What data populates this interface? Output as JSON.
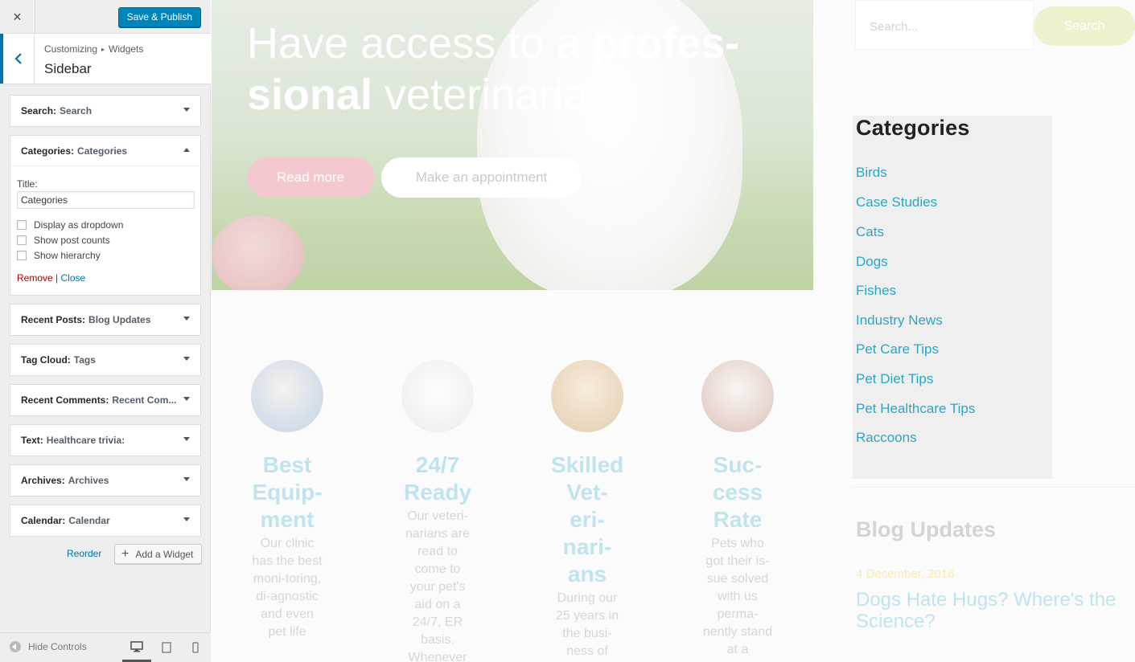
{
  "customizer": {
    "close_icon": "×",
    "save_label": "Save & Publish",
    "breadcrumb": [
      "Customizing",
      "Widgets"
    ],
    "breadcrumb_sep": "▸",
    "section_title": "Sidebar",
    "widgets": [
      {
        "name": "Search:",
        "title": "Search"
      },
      {
        "name": "Categories:",
        "title": "Categories"
      },
      {
        "name": "Recent Posts:",
        "title": "Blog Updates"
      },
      {
        "name": "Tag Cloud:",
        "title": "Tags"
      },
      {
        "name": "Recent Comments:",
        "title": "Recent Com..."
      },
      {
        "name": "Text:",
        "title": "Healthcare trivia:"
      },
      {
        "name": "Archives:",
        "title": "Archives"
      },
      {
        "name": "Calendar:",
        "title": "Calendar"
      }
    ],
    "categories_form": {
      "title_label": "Title:",
      "title_value": "Categories",
      "options": [
        "Display as dropdown",
        "Show post counts",
        "Show hierarchy"
      ],
      "remove_label": "Remove",
      "divider": "|",
      "close_label": "Close"
    },
    "reorder_label": "Reorder",
    "add_widget_label": "Add a Widget",
    "hide_controls_label": "Hide Controls"
  },
  "preview": {
    "hero": {
      "title_part1": "Have access to a ",
      "title_bold": "profes-sional",
      "title_part2": " veterinarian",
      "read_more": "Read more",
      "appointment": "Make an appointment"
    },
    "features": [
      {
        "title": "Best Equip-ment",
        "text": "Our clinic has the best moni-toring, di-agnostic and even pet life"
      },
      {
        "title": "24/7 Ready",
        "text": "Our veteri-narians are read to come to your pet's aid on a 24/7, ER basis. Whenever"
      },
      {
        "title": "Skilled Vet-eri-nari-ans",
        "text": "During our 25 years in the busi-ness of"
      },
      {
        "title": "Suc-cess Rate",
        "text": "Pets who got their is-sue solved with us perma-nently stand at a"
      }
    ],
    "search": {
      "placeholder": "Search...",
      "button": "Search"
    },
    "categories": {
      "title": "Categories",
      "items": [
        "Birds",
        "Case Studies",
        "Cats",
        "Dogs",
        "Fishes",
        "Industry News",
        "Pet Care Tips",
        "Pet Diet Tips",
        "Pet Healthcare Tips",
        "Raccoons"
      ]
    },
    "blog": {
      "title": "Blog Updates",
      "date": "4 December, 2016",
      "post_title": "Dogs Hate Hugs? Where's the Science?"
    }
  }
}
